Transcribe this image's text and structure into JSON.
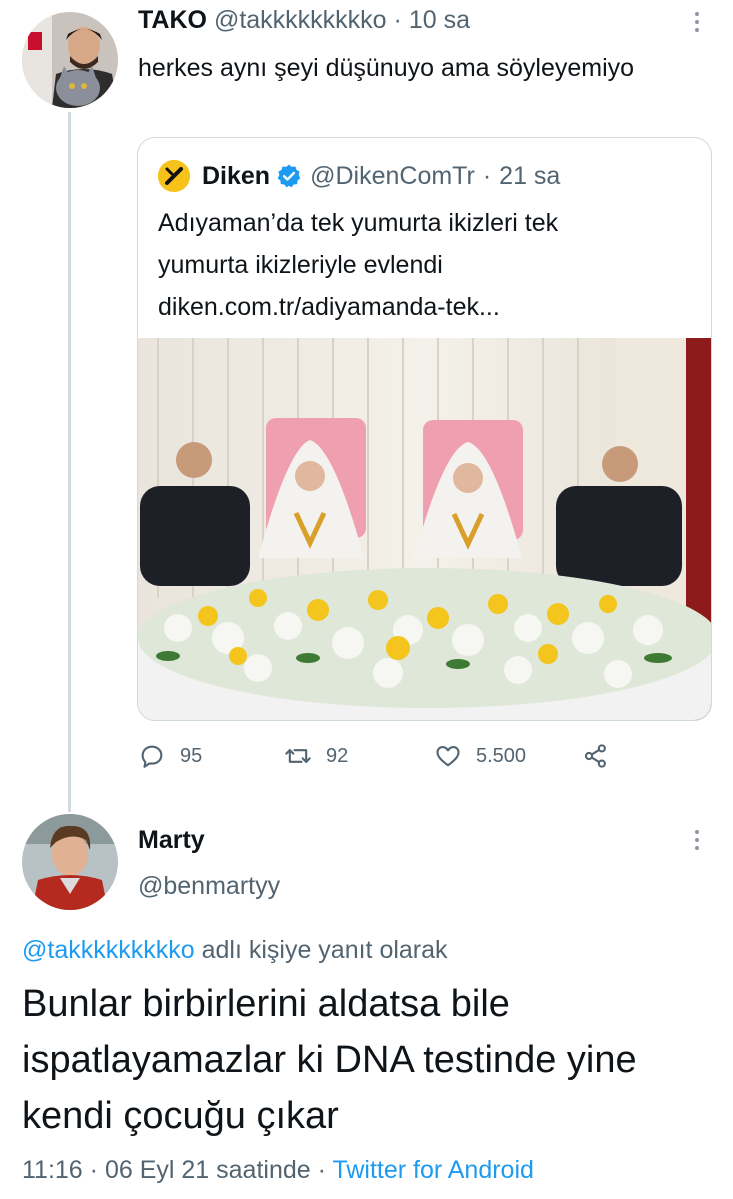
{
  "tweet1": {
    "name": "TAKO",
    "handle": "@takkkkkkkkko",
    "time": "10 sa",
    "separator": "·",
    "text": "herkes aynı şeyi düşünuyo ama söyleyemiyo",
    "avatar_icon": "user-avatar-with-cat"
  },
  "quote": {
    "name": "Diken",
    "handle": "@DikenComTr",
    "time": "21 sa",
    "separator": "·",
    "text_line1": "Adıyaman’da tek yumurta ikizleri tek",
    "text_line2": "yumurta ikizleriyle evlendi",
    "link": "diken.com.tr/adiyamanda-tek...",
    "logo_icon": "diken-logo-icon",
    "verified_icon": "verified-badge-icon",
    "accent_color": "#1d9bf0",
    "image_icon": "wedding-photo"
  },
  "actions": {
    "replies": "95",
    "retweets": "92",
    "likes": "5.500"
  },
  "tweet2": {
    "name": "Marty",
    "handle": "@benmartyy",
    "reply_handle": "@takkkkkkkkko",
    "reply_suffix": " adlı kişiye yanıt olarak",
    "text": "Bunlar birbirlerini aldatsa bile ispatlayamazlar ki DNA testinde yine kendi çocuğu çıkar",
    "time": "11:16",
    "date": "06 Eyl 21 saatinde",
    "separator": "·",
    "source": "Twitter for Android",
    "avatar_icon": "user-avatar-marty"
  },
  "colors": {
    "text": "#0f1419",
    "secondary": "#536471",
    "link": "#1d9bf0",
    "border": "#cfd9de"
  }
}
